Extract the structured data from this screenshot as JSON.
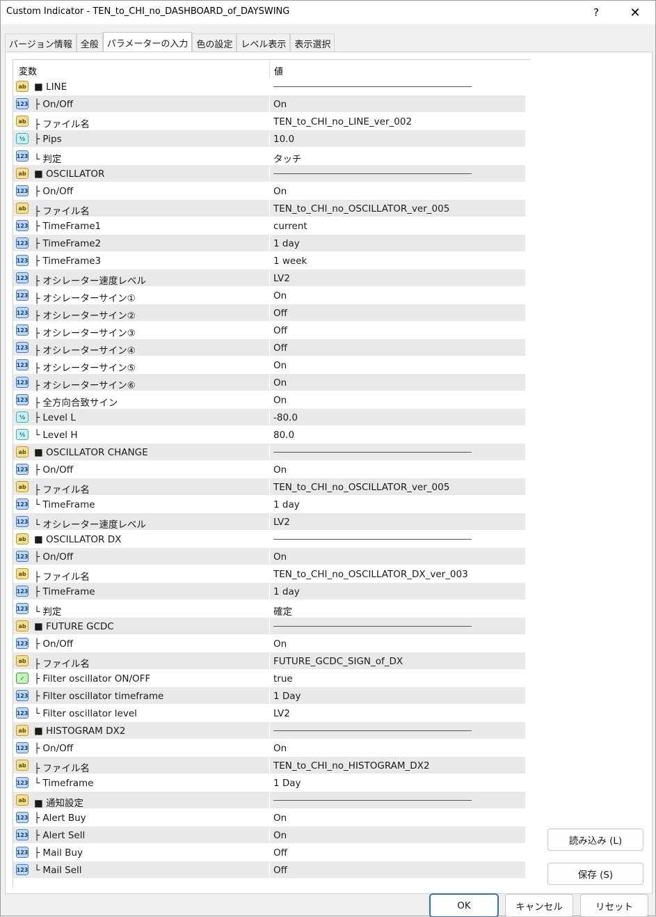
{
  "window": {
    "title": "Custom Indicator - TEN_to_CHI_no_DASHBOARD_of_DAYSWING",
    "help_label": "?",
    "close_label": "✕"
  },
  "tabs": [
    {
      "label": "バージョン情報"
    },
    {
      "label": "全般"
    },
    {
      "label": "パラメーターの入力"
    },
    {
      "label": "色の設定"
    },
    {
      "label": "レベル表示"
    },
    {
      "label": "表示選択"
    }
  ],
  "grid": {
    "col_name": "変数",
    "col_value": "値",
    "rows": [
      {
        "type": "str",
        "name": "■ LINE",
        "value": "",
        "header": true
      },
      {
        "type": "int",
        "name": "├ On/Off",
        "value": "On"
      },
      {
        "type": "str",
        "name": "├ ファイル名",
        "value": "TEN_to_CHI_no_LINE_ver_002"
      },
      {
        "type": "dbl",
        "name": "├ Pips",
        "value": "10.0"
      },
      {
        "type": "int",
        "name": "└ 判定",
        "value": "タッチ"
      },
      {
        "type": "str",
        "name": "■ OSCILLATOR",
        "value": "",
        "header": true
      },
      {
        "type": "int",
        "name": "├ On/Off",
        "value": "On"
      },
      {
        "type": "str",
        "name": "├ ファイル名",
        "value": "TEN_to_CHI_no_OSCILLATOR_ver_005"
      },
      {
        "type": "int",
        "name": "├ TimeFrame1",
        "value": "current"
      },
      {
        "type": "int",
        "name": "├ TimeFrame2",
        "value": "1 day"
      },
      {
        "type": "int",
        "name": "├ TimeFrame3",
        "value": "1 week"
      },
      {
        "type": "int",
        "name": "├ オシレーター速度レベル",
        "value": "LV2"
      },
      {
        "type": "int",
        "name": "├ オシレーターサイン①",
        "value": "On"
      },
      {
        "type": "int",
        "name": "├ オシレーターサイン②",
        "value": "Off"
      },
      {
        "type": "int",
        "name": "├ オシレーターサイン③",
        "value": "Off"
      },
      {
        "type": "int",
        "name": "├ オシレーターサイン④",
        "value": "Off"
      },
      {
        "type": "int",
        "name": "├ オシレーターサイン⑤",
        "value": "On"
      },
      {
        "type": "int",
        "name": "├ オシレーターサイン⑥",
        "value": "On"
      },
      {
        "type": "int",
        "name": "├ 全方向合致サイン",
        "value": "On"
      },
      {
        "type": "dbl",
        "name": "├ Level L",
        "value": "-80.0"
      },
      {
        "type": "dbl",
        "name": "└ Level H",
        "value": "80.0"
      },
      {
        "type": "str",
        "name": "■ OSCILLATOR CHANGE",
        "value": "",
        "header": true
      },
      {
        "type": "int",
        "name": "├ On/Off",
        "value": "On"
      },
      {
        "type": "str",
        "name": "├ ファイル名",
        "value": "TEN_to_CHI_no_OSCILLATOR_ver_005"
      },
      {
        "type": "int",
        "name": "└ TimeFrame",
        "value": "1 day"
      },
      {
        "type": "int",
        "name": "└ オシレーター速度レベル",
        "value": "LV2"
      },
      {
        "type": "str",
        "name": "■ OSCILLATOR DX",
        "value": "",
        "header": true
      },
      {
        "type": "int",
        "name": "├ On/Off",
        "value": "On"
      },
      {
        "type": "str",
        "name": "├ ファイル名",
        "value": "TEN_to_CHI_no_OSCILLATOR_DX_ver_003"
      },
      {
        "type": "int",
        "name": "├ TimeFrame",
        "value": "1 day"
      },
      {
        "type": "int",
        "name": "└ 判定",
        "value": "確定"
      },
      {
        "type": "str",
        "name": "■ FUTURE GCDC",
        "value": "",
        "header": true
      },
      {
        "type": "int",
        "name": "├ On/Off",
        "value": "On"
      },
      {
        "type": "str",
        "name": "├ ファイル名",
        "value": "FUTURE_GCDC_SIGN_of_DX"
      },
      {
        "type": "bool",
        "name": "├ Filter oscillator ON/OFF",
        "value": "true"
      },
      {
        "type": "int",
        "name": "├ Filter oscillator timeframe",
        "value": "1 Day"
      },
      {
        "type": "int",
        "name": "└ Filter oscillator level",
        "value": "LV2"
      },
      {
        "type": "str",
        "name": "■ HISTOGRAM DX2",
        "value": "",
        "header": true
      },
      {
        "type": "int",
        "name": "├ On/Off",
        "value": "On"
      },
      {
        "type": "str",
        "name": "├ ファイル名",
        "value": "TEN_to_CHI_no_HISTOGRAM_DX2"
      },
      {
        "type": "int",
        "name": "└ Timeframe",
        "value": "1 Day"
      },
      {
        "type": "str",
        "name": "■ 通知設定",
        "value": "",
        "header": true
      },
      {
        "type": "int",
        "name": "├ Alert Buy",
        "value": "On"
      },
      {
        "type": "int",
        "name": "├ Alert Sell",
        "value": "On"
      },
      {
        "type": "int",
        "name": "├ Mail Buy",
        "value": "Off"
      },
      {
        "type": "int",
        "name": "└ Mail Sell",
        "value": "Off"
      }
    ]
  },
  "icons": {
    "str": "ab",
    "int": "123",
    "dbl": "½",
    "bool": "✓"
  },
  "buttons": {
    "load": "読み込み (L)",
    "save": "保存 (S)",
    "ok": "OK",
    "cancel": "キャンセル",
    "reset": "リセット"
  }
}
